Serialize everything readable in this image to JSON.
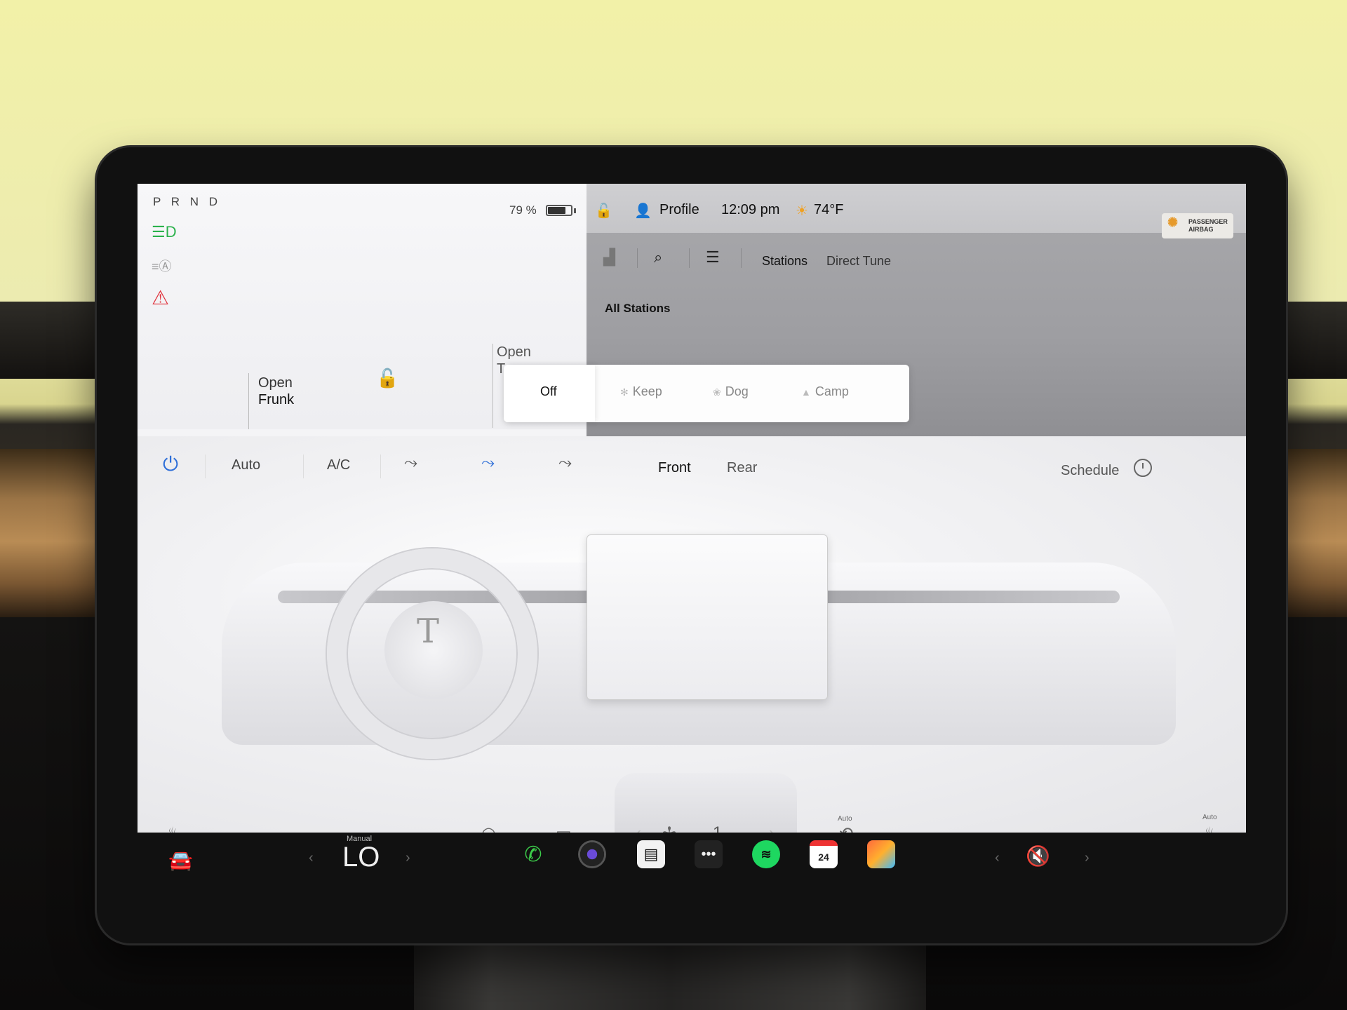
{
  "car": {
    "gear": "P R N D",
    "battery_pct": "79 %",
    "battery_level": 0.79,
    "frunk_label_1": "Open",
    "frunk_label_2": "Frunk",
    "trunk_label_1": "Open",
    "trunk_label_2": "Tr"
  },
  "status_bar": {
    "profile": "Profile",
    "time": "12:09 pm",
    "temperature": "74°F",
    "airbag_line1": "PASSENGER",
    "airbag_line2": "AIRBAG"
  },
  "media": {
    "tabs": [
      "Stations",
      "Direct Tune"
    ],
    "section_title": "All Stations"
  },
  "modes": {
    "items": [
      "Off",
      "Keep",
      "Dog",
      "Camp"
    ],
    "selected": "Off"
  },
  "climate": {
    "auto": "Auto",
    "ac": "A/C",
    "zone_tabs": [
      "Front",
      "Rear"
    ],
    "schedule": "Schedule",
    "fan_speed": "1",
    "auto_small_1": "Auto",
    "auto_small_2": "Auto"
  },
  "dock": {
    "temp_mode": "Manual",
    "temp_value": "LO",
    "calendar_day": "24",
    "more": "•••"
  },
  "colors": {
    "accent_blue": "#2f6fd8",
    "lights_green": "#2bb24c",
    "seatbelt_red": "#e0323c",
    "spotify_green": "#1ed760"
  }
}
